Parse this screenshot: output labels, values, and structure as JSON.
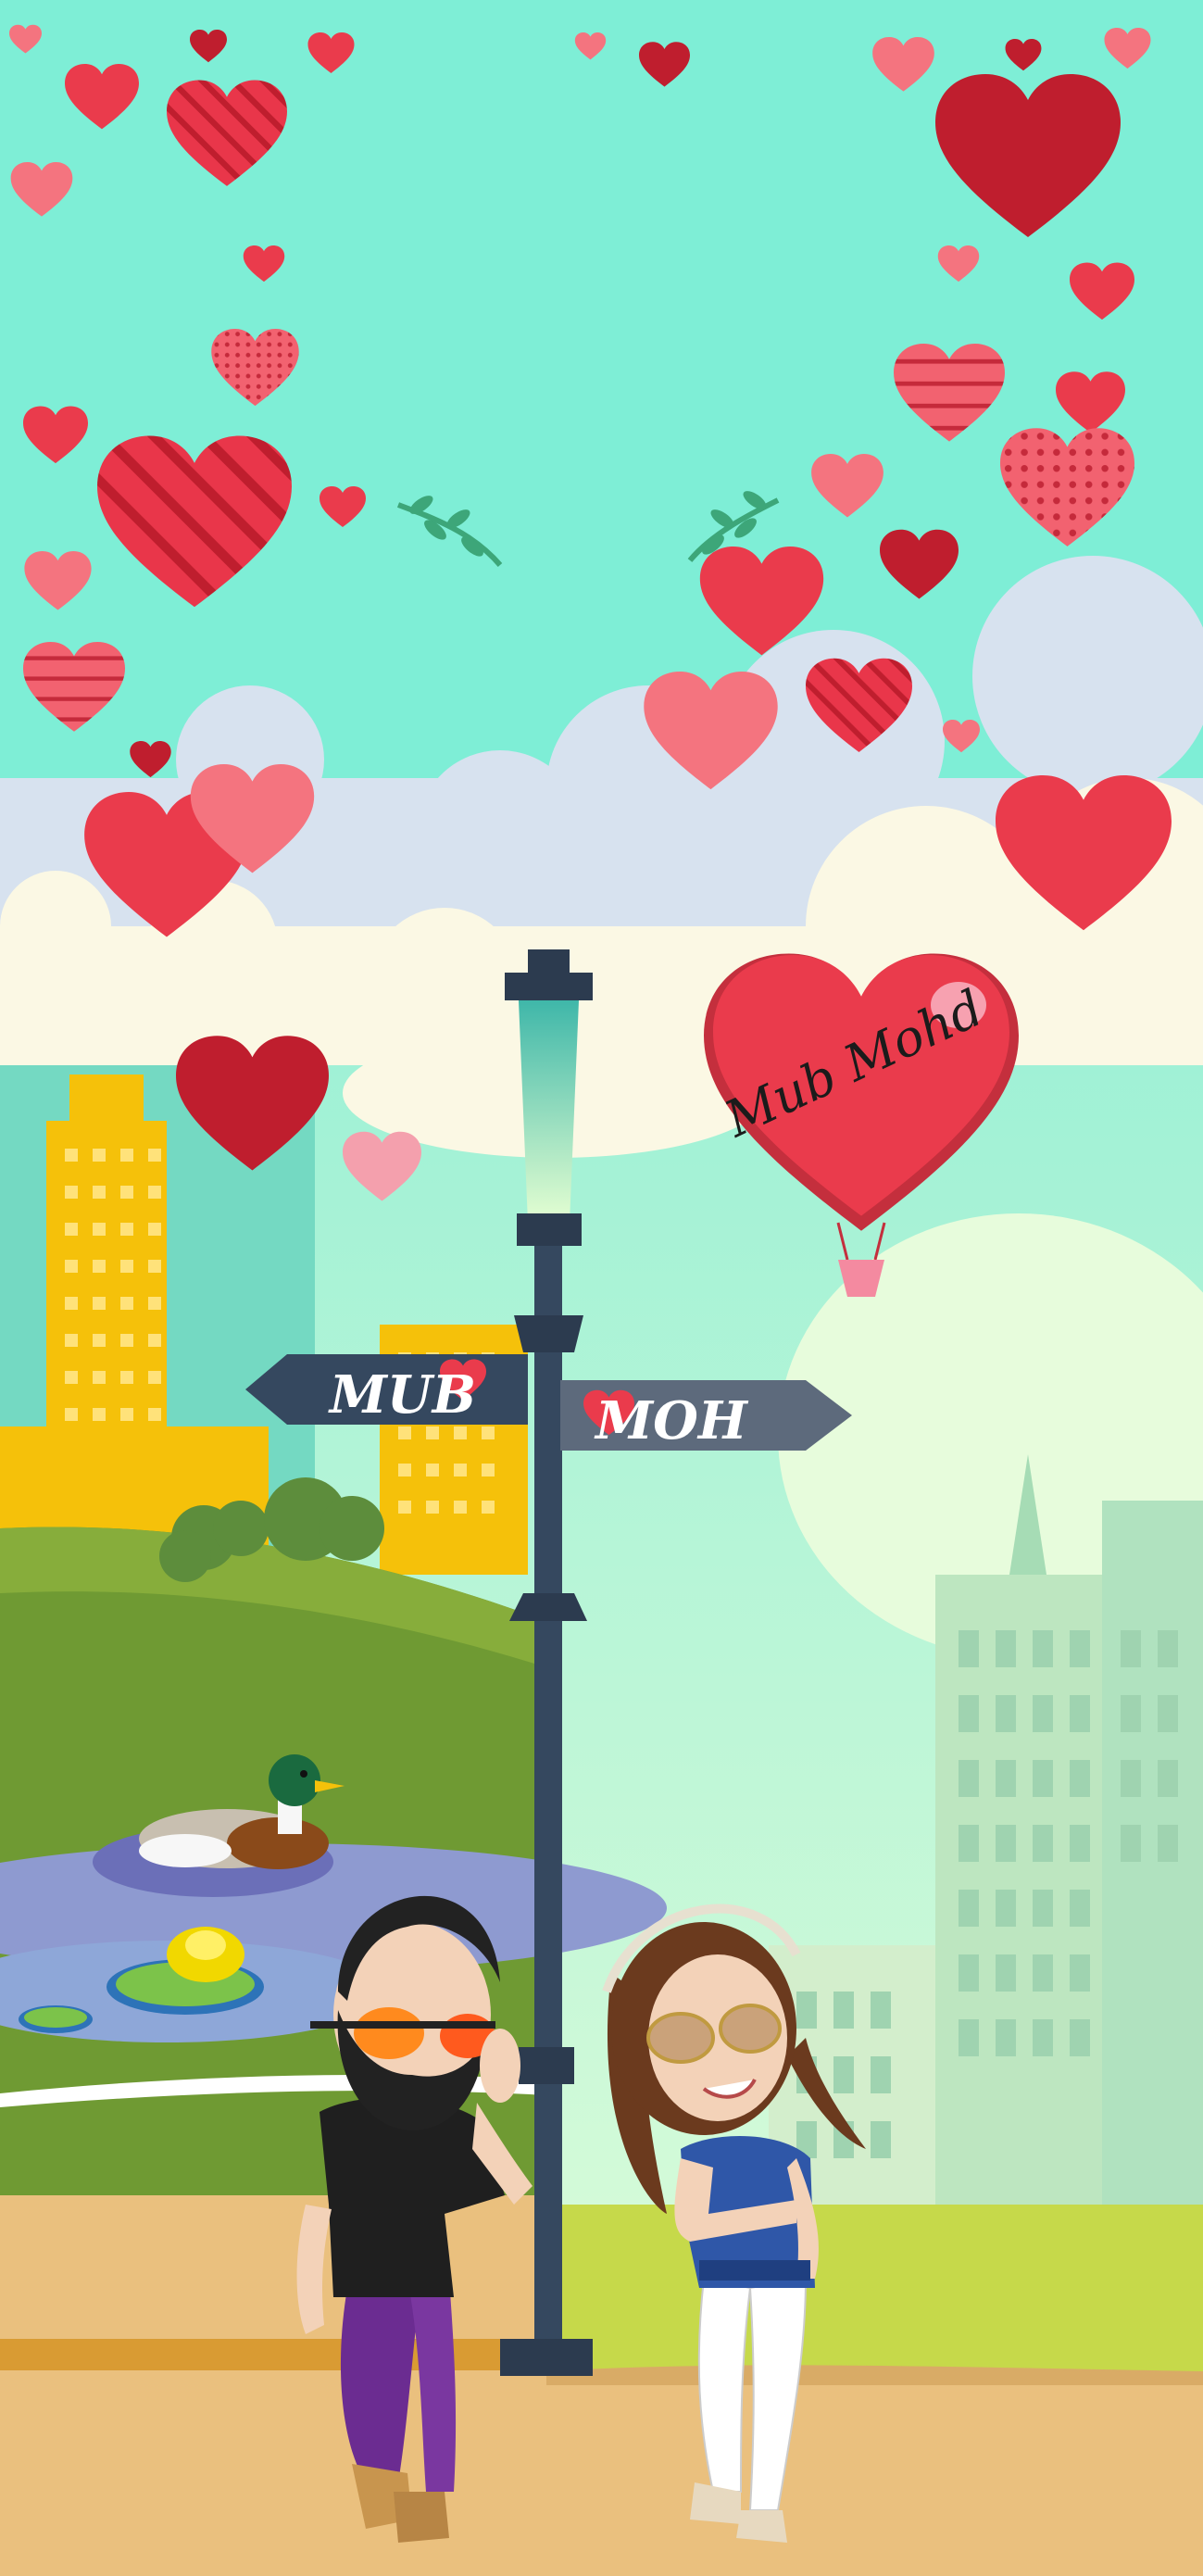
{
  "signpost": {
    "left_sign_label": "MUB",
    "right_sign_label": "MOH"
  },
  "balloon": {
    "signature_text": "Mub Mohd"
  },
  "colors": {
    "sky": "#7eeed6",
    "heart_red": "#e9364a",
    "heart_dark": "#bf1e2e",
    "heart_pink": "#f47b8a",
    "sign_board": "#35485f",
    "ground": "#eac07e"
  }
}
